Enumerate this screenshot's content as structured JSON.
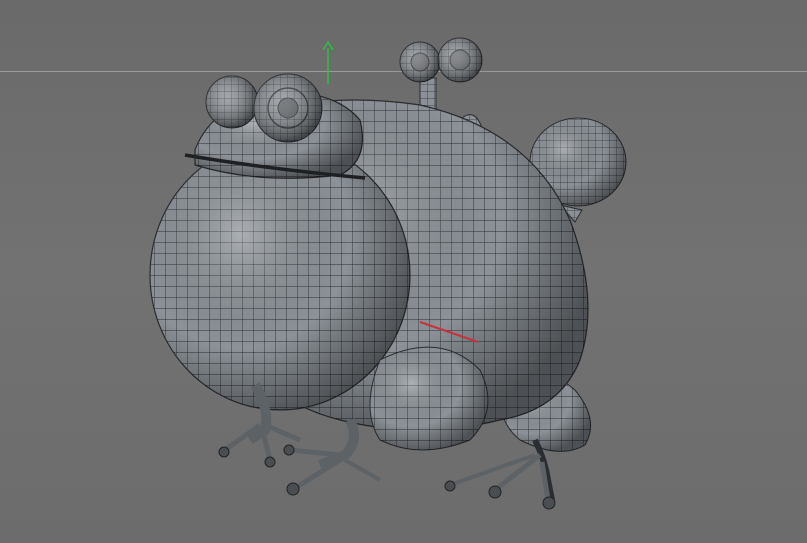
{
  "viewport": {
    "background_color": "#6f6f6f",
    "horizon_color": "#9a9a9a",
    "mesh_fill_color": "#8e949a",
    "mesh_wire_color": "#2a2d31",
    "axis_y_color": "#2fbf3f",
    "axis_x_color": "#c8323c"
  },
  "model": {
    "icon": "wireframe-frog-windup-toy"
  }
}
